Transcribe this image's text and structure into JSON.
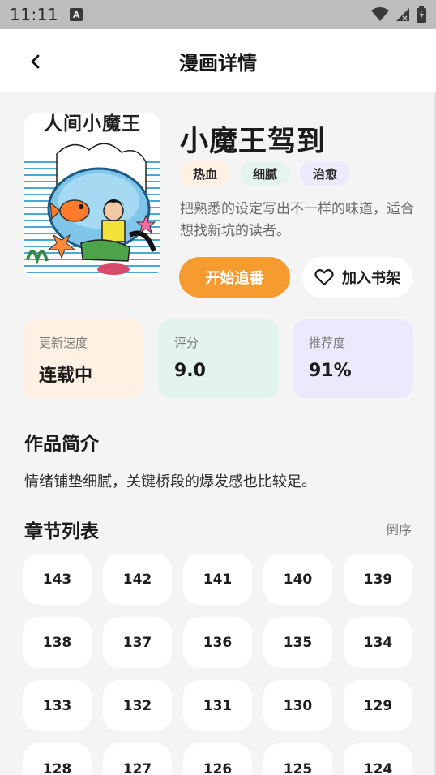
{
  "status_bar": {
    "time": "11:11",
    "notification_badge": "A"
  },
  "header": {
    "title": "漫画详情"
  },
  "book": {
    "cover_title": "人间小魔王",
    "title": "小魔王驾到",
    "tags": [
      "热血",
      "细腻",
      "治愈"
    ],
    "description": "把熟悉的设定写出不一样的味道，适合想找新坑的读者。"
  },
  "actions": {
    "follow_label": "开始追番",
    "shelf_label": "加入书架"
  },
  "stats": [
    {
      "label": "更新速度",
      "value": "连载中"
    },
    {
      "label": "评分",
      "value": "9.0"
    },
    {
      "label": "推荐度",
      "value": "91%"
    }
  ],
  "intro": {
    "heading": "作品简介",
    "text": "情绪铺垫细腻，关键桥段的爆发感也比较足。"
  },
  "chapters": {
    "heading": "章节列表",
    "sort_label": "倒序",
    "items": [
      "143",
      "142",
      "141",
      "140",
      "139",
      "138",
      "137",
      "136",
      "135",
      "134",
      "133",
      "132",
      "131",
      "130",
      "129",
      "128",
      "127",
      "126",
      "125",
      "124"
    ]
  },
  "colors": {
    "accent": "#f59b2f",
    "tag_hot": "#fff0e4",
    "tag_delicate": "#e6f4ee",
    "tag_heal": "#ecebfb"
  }
}
